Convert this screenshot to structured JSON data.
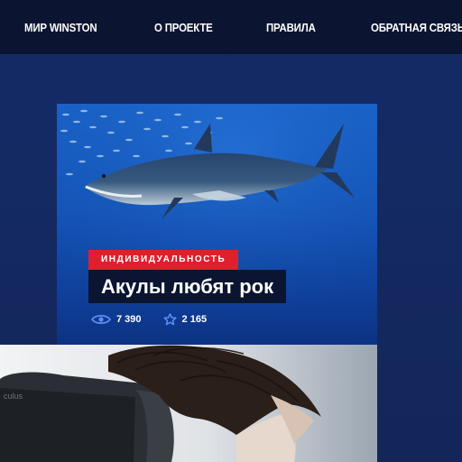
{
  "nav": {
    "items": [
      {
        "label": "МИР WINSTON"
      },
      {
        "label": "О ПРОЕКТЕ"
      },
      {
        "label": "ПРАВИЛА"
      },
      {
        "label": "ОБРАТНАЯ СВЯЗЬ"
      }
    ]
  },
  "card": {
    "tag": "ИНДИВИДУАЛЬНОСТЬ",
    "title": "Акулы любят рок",
    "views": "7 390",
    "stars": "2 165"
  },
  "colors": {
    "background": "#142a63",
    "nav_bg": "#0b1430",
    "tag_red": "#e01f2d",
    "icon_blue": "#5b8ff5"
  }
}
